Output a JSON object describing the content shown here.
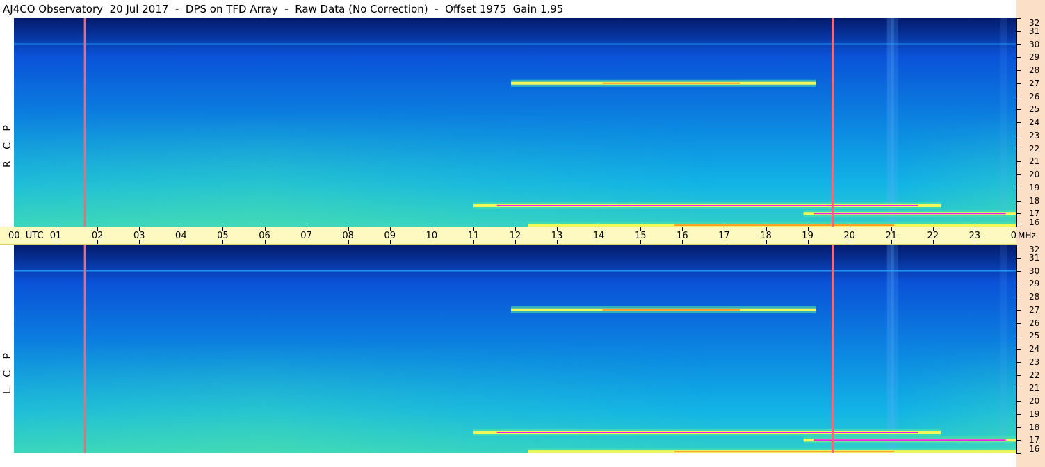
{
  "title": "AJ4CO Observatory  20 Jul 2017  -  DPS on TFD Array  -  Raw Data (No Correction)  -  Offset 1975  Gain 1.95",
  "colors": {
    "bg_top": "#041a6b",
    "bg_mid": "#0a52d8",
    "bg_low": "#12b4e6",
    "bg_green": "#4fe3a6",
    "yellow": "#f2f75a",
    "orange": "#ff9a2b",
    "magenta": "#e61ef0",
    "marker": "#f06a78",
    "time_bar": "#fdf9c0",
    "freq_axis_bg": "#fbdfc7"
  },
  "chart_data": {
    "type": "heatmap",
    "time_axis": {
      "unit": "UTC",
      "tick_labels": [
        "00",
        "01",
        "02",
        "03",
        "04",
        "05",
        "06",
        "07",
        "08",
        "09",
        "10",
        "11",
        "12",
        "13",
        "14",
        "15",
        "16",
        "17",
        "18",
        "19",
        "20",
        "21",
        "22",
        "23",
        "00"
      ],
      "utc_suffix": "UTC",
      "range_hours": [
        0,
        24
      ]
    },
    "freq_axis": {
      "unit": "MHz",
      "tick_labels": [
        32,
        31,
        30,
        29,
        28,
        27,
        26,
        25,
        24,
        23,
        22,
        21,
        20,
        19,
        18,
        17,
        16
      ],
      "range_mhz": [
        16,
        32
      ]
    },
    "panels": [
      {
        "name": "R C P",
        "polarization": "RCP"
      },
      {
        "name": "L C P",
        "polarization": "LCP"
      }
    ],
    "markers_utc_hours": [
      1.7,
      19.6
    ],
    "features": [
      {
        "type": "band",
        "start_h": 11.9,
        "end_h": 19.2,
        "freq_mhz": 27.0,
        "intensity": "high"
      },
      {
        "type": "band",
        "start_h": 11.0,
        "end_h": 22.2,
        "freq_mhz": 17.6,
        "intensity": "very high"
      },
      {
        "type": "band",
        "start_h": 18.9,
        "end_h": 24.0,
        "freq_mhz": 17.0,
        "intensity": "very high"
      },
      {
        "type": "band",
        "start_h": 12.3,
        "end_h": 24.0,
        "freq_mhz": 16.1,
        "intensity": "high"
      },
      {
        "type": "line",
        "start_h": 0.0,
        "end_h": 24.0,
        "freq_mhz": 30.0,
        "intensity": "low"
      }
    ]
  }
}
